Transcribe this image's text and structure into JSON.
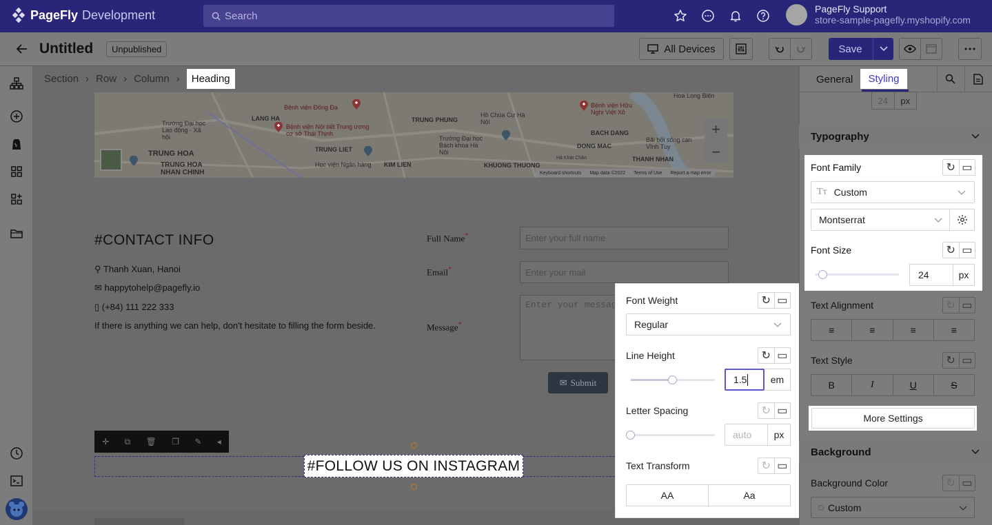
{
  "topbar": {
    "brand": "PageFly",
    "env": "Development",
    "search_placeholder": "Search",
    "account_name": "PageFly Support",
    "account_store": "store-sample-pagefly.myshopify.com"
  },
  "toolbar": {
    "title": "Untitled",
    "status": "Unpublished",
    "devices_label": "All Devices",
    "save_label": "Save"
  },
  "breadcrumb": [
    "Section",
    "Row",
    "Column",
    "Heading"
  ],
  "map": {
    "labels": [
      "LANG HA",
      "TRUNG PHUNG",
      "KIM LIEN",
      "BACH DANG",
      "TRUNG HOA",
      "TRUNG HOA NHAN CHINH",
      "TRUNG LIET",
      "DONG MAC",
      "KHUONG THUONG",
      "THANH NHAN"
    ],
    "poi": [
      "Bệnh viện Đống Đa",
      "Trường Đại học Lao động - Xã hội",
      "Bệnh viện Nội tiết Trung ương cơ sở Thái Thịnh",
      "Hồ Chùa Cự Hà Nội",
      "Bệnh viện Hữu Nghị Việt Xô",
      "Trường Đại học Bách khoa Hà Nội",
      "Học viện Ngân hàng",
      "Bãi bồi sông cạn Vĩnh Tuy",
      "Hoa Long Biên",
      "Hà Khát Chân"
    ],
    "footer": [
      "Keyboard shortcuts",
      "Map data ©2022",
      "Terms of Use",
      "Report a map error"
    ]
  },
  "contact": {
    "heading": "#CONTACT INFO",
    "address": "Thanh Xuan, Hanoi",
    "email": "happytohelp@pagefly.io",
    "phone": "(+84) 111 222 333",
    "note": "If there is anything we can help, don't hesitate to filling the form beside.",
    "form": {
      "name_label": "Full Name",
      "name_placeholder": "Enter your full name",
      "email_label": "Email",
      "email_placeholder": "Enter your mail",
      "message_label": "Message",
      "message_placeholder": "Enter your message",
      "submit": "Submit"
    }
  },
  "selected_heading": "#FOLLOW US ON INSTAGRAM",
  "popup": {
    "font_weight_label": "Font Weight",
    "font_weight_value": "Regular",
    "line_height_label": "Line Height",
    "line_height_value": "1.5",
    "line_height_unit": "em",
    "line_height_level": 0.5,
    "letter_spacing_label": "Letter Spacing",
    "letter_spacing_placeholder": "auto",
    "letter_spacing_unit": "px",
    "letter_spacing_level": 0,
    "text_transform_label": "Text Transform",
    "transform_options": [
      "AA",
      "Aa"
    ]
  },
  "panel": {
    "tabs": [
      "General",
      "Styling"
    ],
    "active_tab": "Styling",
    "top_value": "24",
    "top_unit": "px",
    "typography_title": "Typography",
    "font_family_label": "Font Family",
    "font_source": "Custom",
    "font_name": "Montserrat",
    "font_size_label": "Font Size",
    "font_size_value": "24",
    "font_size_unit": "px",
    "text_alignment_label": "Text Alignment",
    "text_style_label": "Text Style",
    "text_style_buttons": [
      "B",
      "I",
      "U",
      "S"
    ],
    "more_settings": "More Settings",
    "background_title": "Background",
    "background_color_label": "Background Color",
    "background_color_value": "Custom"
  }
}
